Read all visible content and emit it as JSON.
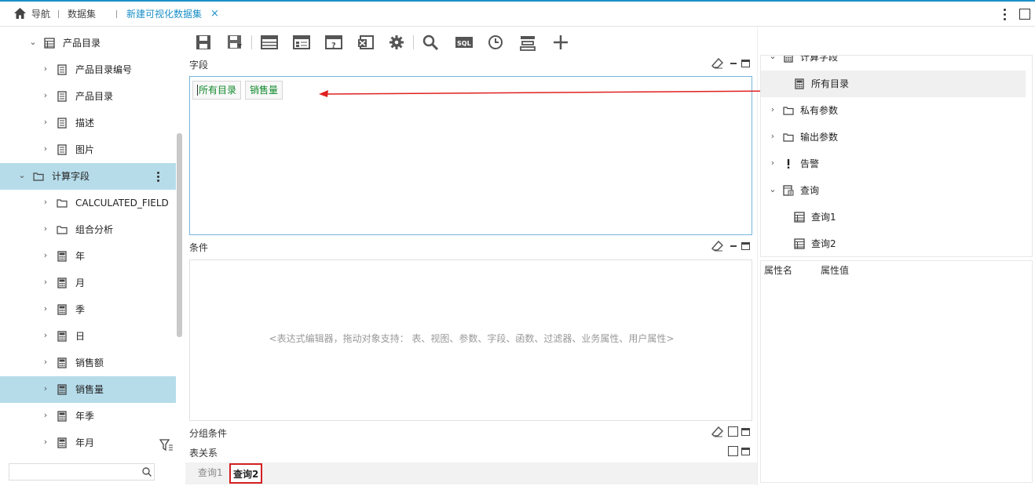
{
  "topbar": {
    "nav_label": "导航",
    "dataset_label": "数据集",
    "active_tab_label": "新建可视化数据集",
    "close_glyph": "×"
  },
  "left_tree": {
    "items": [
      {
        "label": "产品目录",
        "icon": "table-icon",
        "expanded": true,
        "selected": false
      },
      {
        "label": "产品目录编号",
        "icon": "field-icon",
        "expanded": false,
        "selected": false
      },
      {
        "label": "产品目录",
        "icon": "field-icon",
        "expanded": false,
        "selected": false
      },
      {
        "label": "描述",
        "icon": "field-icon",
        "expanded": false,
        "selected": false
      },
      {
        "label": "图片",
        "icon": "field-icon",
        "expanded": false,
        "selected": false
      },
      {
        "label": "计算字段",
        "icon": "folder-icon",
        "expanded": true,
        "selected": true
      },
      {
        "label": "CALCULATED_FIELD",
        "icon": "folder-icon",
        "expanded": false,
        "selected": false
      },
      {
        "label": "组合分析",
        "icon": "folder-icon",
        "expanded": false,
        "selected": false
      },
      {
        "label": "年",
        "icon": "calculator-icon",
        "expanded": false,
        "selected": false
      },
      {
        "label": "月",
        "icon": "calculator-icon",
        "expanded": false,
        "selected": false
      },
      {
        "label": "季",
        "icon": "calculator-icon",
        "expanded": false,
        "selected": false
      },
      {
        "label": "日",
        "icon": "calculator-icon",
        "expanded": false,
        "selected": false
      },
      {
        "label": "销售额",
        "icon": "calculator-icon",
        "expanded": false,
        "selected": false
      },
      {
        "label": "销售量",
        "icon": "calculator-icon",
        "expanded": false,
        "selected": true
      },
      {
        "label": "年季",
        "icon": "calculator-icon",
        "expanded": false,
        "selected": false
      },
      {
        "label": "年月",
        "icon": "calculator-icon",
        "expanded": false,
        "selected": false
      }
    ],
    "search_value": ""
  },
  "toolbar": {
    "buttons": [
      "save-icon",
      "save-as-icon",
      "table-icon",
      "table-field-icon",
      "parameter-icon",
      "excel-icon",
      "settings-icon",
      "search-icon",
      "sql-icon",
      "cache-clock-icon",
      "output-fields-icon",
      "add-icon"
    ]
  },
  "fields_section": {
    "title": "字段",
    "tags": [
      "所有目录",
      "销售量"
    ]
  },
  "conditions_section": {
    "title": "条件",
    "hint": "<表达式编辑器，拖动对象支持： 表、视图、参数、字段、函数、过滤器、业务属性、用户属性>"
  },
  "group_section": {
    "title": "分组条件"
  },
  "relation_section": {
    "title": "表关系"
  },
  "bottom_tabs": [
    {
      "label": "查询1",
      "active": false
    },
    {
      "label": "查询2",
      "active": true
    }
  ],
  "right_tree": {
    "items": [
      {
        "label": "计算字段",
        "icon": "calculator-icon",
        "expanded": true,
        "level": 0,
        "partial": true
      },
      {
        "label": "所有目录",
        "icon": "calculator-icon",
        "expanded": false,
        "level": 1,
        "selected": true
      },
      {
        "label": "私有参数",
        "icon": "folder-icon",
        "expanded": false,
        "level": 0
      },
      {
        "label": "输出参数",
        "icon": "folder-icon",
        "expanded": false,
        "level": 0
      },
      {
        "label": "告警",
        "icon": "alert-icon",
        "expanded": false,
        "level": 0
      },
      {
        "label": "查询",
        "icon": "query-icon",
        "expanded": true,
        "level": 0
      },
      {
        "label": "查询1",
        "icon": "table-icon",
        "expanded": false,
        "level": 1
      },
      {
        "label": "查询2",
        "icon": "table-icon",
        "expanded": false,
        "level": 1
      }
    ]
  },
  "properties": {
    "name_header": "属性名",
    "value_header": "属性值"
  },
  "colors": {
    "accent": "#1a8fc7",
    "selected_row": "#b6dcea",
    "field_text": "#118a2c",
    "drag_arrow": "#e02020",
    "active_tab_border": "#d42020"
  }
}
